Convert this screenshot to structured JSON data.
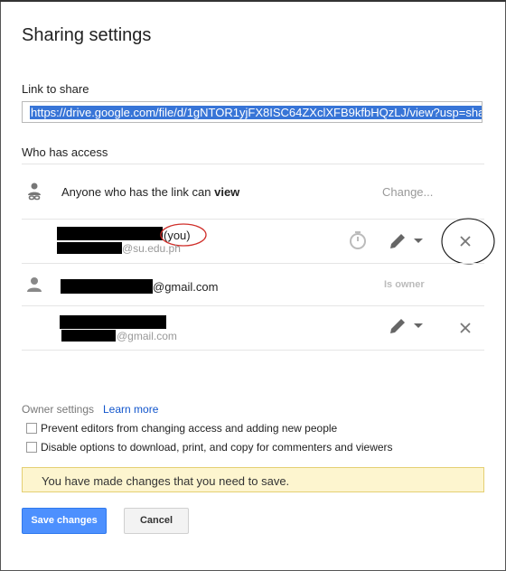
{
  "dialog": {
    "title": "Sharing settings",
    "link_label": "Link to share",
    "link_value": "https://drive.google.com/file/d/1gNTOR1yjFX8ISC64ZXclXFB9kfbHQzLJ/view?usp=sha",
    "who_has_access": "Who has access"
  },
  "access_rows": {
    "anyone_text": "Anyone who has the link can ",
    "anyone_permission": "view",
    "anyone_change": "Change...",
    "user1_you": "(you)",
    "user1_email_suffix": "@su.edu.ph",
    "user2_email_suffix": "@gmail.com",
    "user2_role": "Is owner",
    "user3_email_suffix": "@gmail.com"
  },
  "owner_settings": {
    "label": "Owner settings",
    "learn_more": "Learn more",
    "option1": "Prevent editors from changing access and adding new people",
    "option2": "Disable options to download, print, and copy for commenters and viewers"
  },
  "notice": "You have made changes that you need to save.",
  "buttons": {
    "save": "Save changes",
    "cancel": "Cancel"
  },
  "colors": {
    "primary_button": "#4d90fe",
    "link": "#1155cc",
    "notice_bg": "#fdf5cf"
  },
  "icons": [
    "link-person-icon",
    "timer-icon",
    "pencil-icon",
    "dropdown-caret-icon",
    "close-icon",
    "person-icon"
  ]
}
